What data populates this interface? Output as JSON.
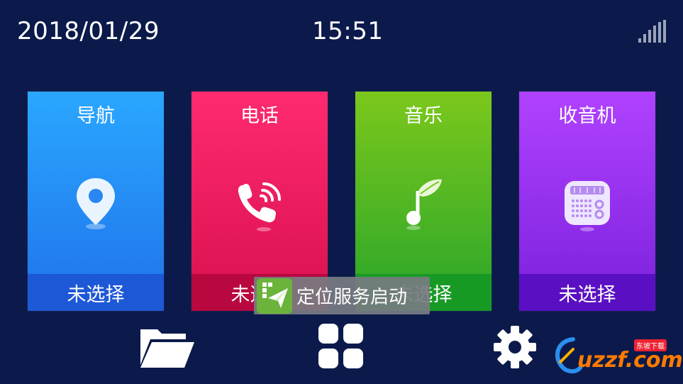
{
  "status_bar": {
    "date": "2018/01/29",
    "time": "15:51",
    "signal_icon": "signal-bars-icon"
  },
  "cards": [
    {
      "title": "导航",
      "footer": "未选择",
      "icon": "location-pin-icon",
      "color": "#1f72ea"
    },
    {
      "title": "电话",
      "footer": "未选择",
      "icon": "phone-icon",
      "color": "#d8104f"
    },
    {
      "title": "音乐",
      "footer": "未选择",
      "icon": "music-note-leaf-icon",
      "color": "#28a52a"
    },
    {
      "title": "收音机",
      "footer": "未选择",
      "icon": "radio-icon",
      "color": "#7a20dc"
    }
  ],
  "bottom_bar": {
    "folder_icon": "folder-icon",
    "apps_icon": "apps-grid-icon",
    "settings_icon": "gear-icon"
  },
  "toast": {
    "text": "定位服务启动",
    "icon": "location-service-app-icon"
  },
  "watermark": {
    "text": "uzzf.com",
    "badge": "东坡下载"
  }
}
